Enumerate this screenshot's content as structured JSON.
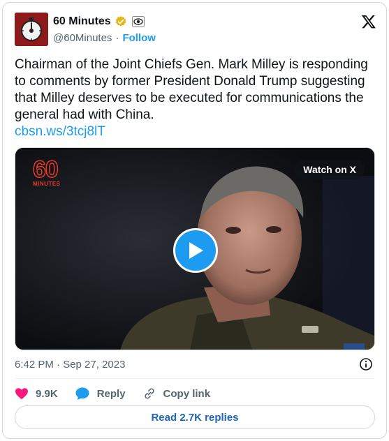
{
  "account": {
    "name": "60 Minutes",
    "handle": "@60Minutes",
    "separator": "·",
    "follow_label": "Follow"
  },
  "tweet": {
    "text": "Chairman of the Joint Chiefs Gen. Mark Milley is responding to comments by former President Donald Trump suggesting that Milley deserves to be executed for communications the general had with China.",
    "link": "cbsn.ws/3tcj8lT"
  },
  "media": {
    "logo_number": "60",
    "logo_word": "MINUTES",
    "watch_label": "Watch on X"
  },
  "meta": {
    "timestamp": "6:42 PM · Sep 27, 2023"
  },
  "actions": {
    "likes": "9.9K",
    "reply_label": "Reply",
    "copy_link_label": "Copy link"
  },
  "replies_button": "Read 2.7K replies",
  "colors": {
    "accent": "#1d9bf0",
    "like": "#f91880",
    "verified_gold": "#e2b719"
  },
  "icons": [
    "avatar-logo",
    "verified-badge-icon",
    "affiliate-logo-icon",
    "x-logo-icon",
    "play-icon",
    "info-icon",
    "heart-icon",
    "reply-bubble-icon",
    "link-icon"
  ]
}
